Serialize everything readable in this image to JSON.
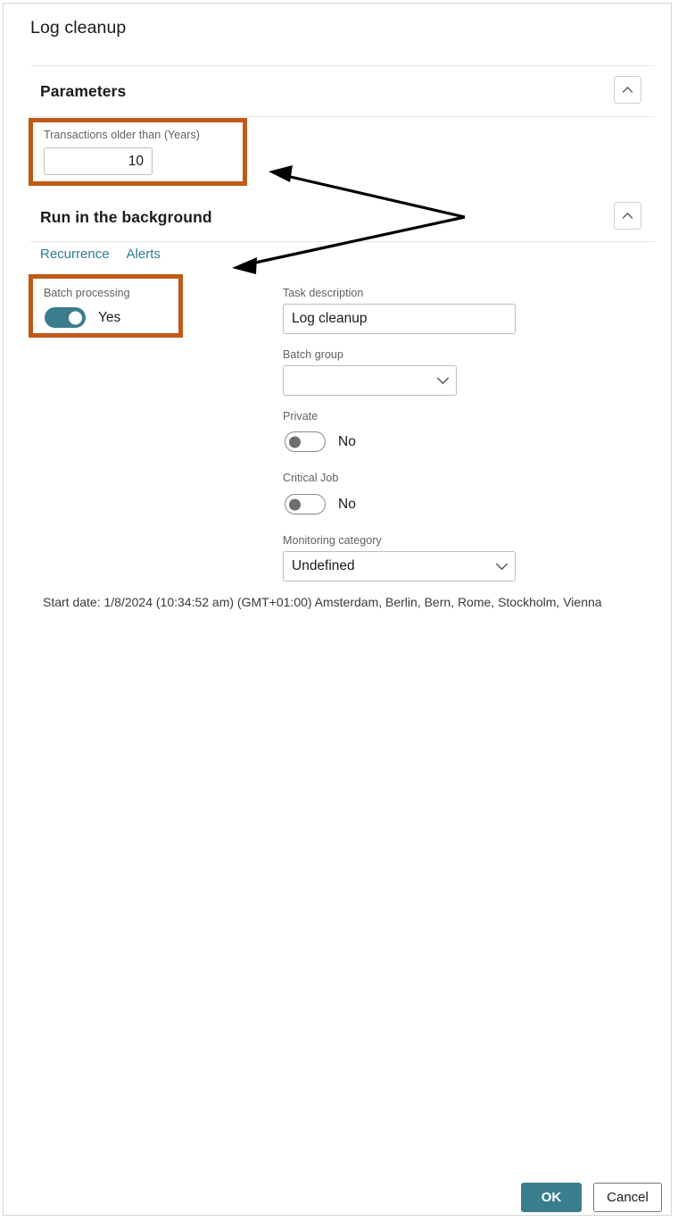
{
  "dialog": {
    "title": "Log cleanup"
  },
  "sections": {
    "parameters": {
      "header": "Parameters",
      "collapse_icon": "chevron-up-icon",
      "fields": {
        "transactions_older_than": {
          "label": "Transactions older than (Years)",
          "value": "10"
        }
      }
    },
    "run_in_background": {
      "header": "Run in the background",
      "collapse_icon": "chevron-up-icon",
      "tabs": [
        {
          "label": "Recurrence"
        },
        {
          "label": "Alerts"
        }
      ],
      "left_column": {
        "batch_processing": {
          "label": "Batch processing",
          "state": "on",
          "value_text": "Yes"
        }
      },
      "right_column": {
        "task_description": {
          "label": "Task description",
          "value": "Log cleanup",
          "placeholder": ""
        },
        "batch_group": {
          "label": "Batch group",
          "value": "",
          "chevron_icon": "chevron-down-icon"
        },
        "private": {
          "label": "Private",
          "state": "off",
          "value_text": "No"
        },
        "critical_job": {
          "label": "Critical Job",
          "state": "off",
          "value_text": "No"
        },
        "monitoring_category": {
          "label": "Monitoring category",
          "value": "Undefined",
          "chevron_icon": "chevron-down-icon"
        }
      },
      "start_date": "Start date: 1/8/2024 (10:34:52 am) (GMT+01:00) Amsterdam, Berlin, Bern, Rome, Stockholm, Vienna"
    }
  },
  "footer": {
    "ok_label": "OK",
    "cancel_label": "Cancel"
  },
  "colors": {
    "accent_teal": "#3a7d8c",
    "tab_link": "#2e7d91",
    "annotation_orange": "#c05a16",
    "arrow_black": "#000000",
    "border_gray": "#bdbdbd"
  },
  "annotations": {
    "highlight_count": 2,
    "arrow_count": 2
  }
}
